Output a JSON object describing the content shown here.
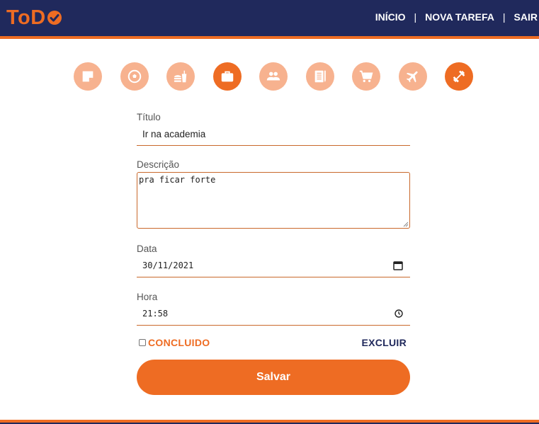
{
  "header": {
    "logo_text": "ToD",
    "nav": {
      "home": "INÍCIO",
      "new_task": "NOVA TAREFA",
      "logout": "SAIR",
      "separator": "|"
    },
    "colors": {
      "navy": "#20295c",
      "orange": "#ee6c23"
    }
  },
  "categories": [
    {
      "icon": "sticky-note-icon",
      "selected": false
    },
    {
      "icon": "soccer-ball-icon",
      "selected": false
    },
    {
      "icon": "fast-food-icon",
      "selected": false
    },
    {
      "icon": "briefcase-icon",
      "selected": true
    },
    {
      "icon": "people-icon",
      "selected": false
    },
    {
      "icon": "notebook-icon",
      "selected": false
    },
    {
      "icon": "shopping-cart-icon",
      "selected": false
    },
    {
      "icon": "airplane-icon",
      "selected": false
    },
    {
      "icon": "dumbbell-icon",
      "selected": true
    }
  ],
  "form": {
    "title_label": "Título",
    "title_value": "Ir na academia",
    "description_label": "Descrição",
    "description_value": "pra ficar forte",
    "date_label": "Data",
    "date_value": "30/11/2021",
    "time_label": "Hora",
    "time_value": "21:58",
    "done_label": "CONCLUIDO",
    "delete_label": "EXCLUIR",
    "save_label": "Salvar"
  }
}
